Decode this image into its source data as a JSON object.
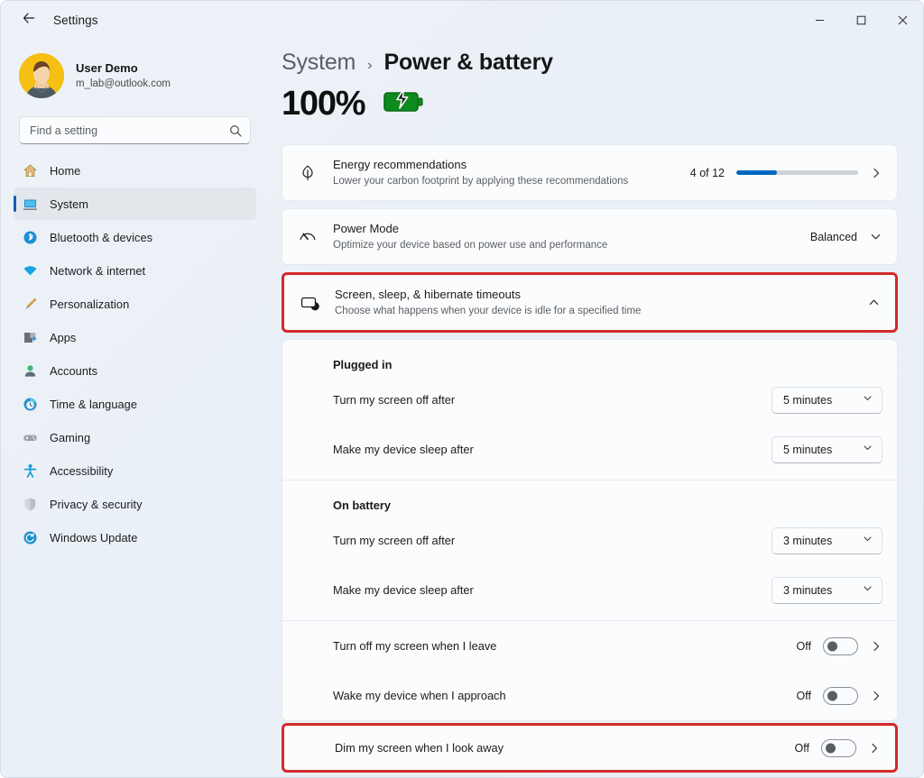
{
  "window": {
    "title": "Settings",
    "back_icon": "back-arrow-icon",
    "minimize": "–",
    "maximize": "▢",
    "close": "✕"
  },
  "sidebar": {
    "account": {
      "name": "User Demo",
      "email": "m_lab@outlook.com",
      "avatar_color": "#f5bf13"
    },
    "search": {
      "placeholder": "Find a setting",
      "value": "",
      "icon": "search-icon"
    },
    "items": [
      {
        "label": "Home",
        "icon": "home-icon",
        "active": false
      },
      {
        "label": "System",
        "icon": "system-icon",
        "active": true
      },
      {
        "label": "Bluetooth & devices",
        "icon": "bluetooth-icon",
        "active": false
      },
      {
        "label": "Network & internet",
        "icon": "wifi-icon",
        "active": false
      },
      {
        "label": "Personalization",
        "icon": "brush-icon",
        "active": false
      },
      {
        "label": "Apps",
        "icon": "apps-icon",
        "active": false
      },
      {
        "label": "Accounts",
        "icon": "account-icon",
        "active": false
      },
      {
        "label": "Time & language",
        "icon": "clock-icon",
        "active": false
      },
      {
        "label": "Gaming",
        "icon": "gamepad-icon",
        "active": false
      },
      {
        "label": "Accessibility",
        "icon": "accessibility-icon",
        "active": false
      },
      {
        "label": "Privacy & security",
        "icon": "shield-icon",
        "active": false
      },
      {
        "label": "Windows Update",
        "icon": "update-icon",
        "active": false
      }
    ]
  },
  "main": {
    "breadcrumb": {
      "parent": "System",
      "separator": "›",
      "current": "Power & battery"
    },
    "battery": {
      "percent": "100%",
      "icon": "battery-charging-icon",
      "icon_color": "#107c10"
    },
    "energy_recommendations": {
      "title": "Energy recommendations",
      "subtitle": "Lower your carbon footprint by applying these recommendations",
      "count_text": "4 of 12",
      "progress_percent": 33,
      "progress_color": "#0067c0",
      "icon": "leaf-icon",
      "chevron": "chevron-right-icon"
    },
    "power_mode": {
      "title": "Power Mode",
      "subtitle": "Optimize your device based on power use and performance",
      "value": "Balanced",
      "icon": "gauge-icon",
      "chevron": "chevron-down-icon"
    },
    "timeouts": {
      "title": "Screen, sleep, & hibernate timeouts",
      "subtitle": "Choose what happens when your device is idle for a specified time",
      "icon": "monitor-sleep-icon",
      "chevron": "chevron-up-icon",
      "highlighted": true,
      "highlight_color": "#d32a2a",
      "groups": [
        {
          "heading": "Plugged in",
          "rows": [
            {
              "label": "Turn my screen off after",
              "value": "5 minutes"
            },
            {
              "label": "Make my device sleep after",
              "value": "5 minutes"
            }
          ]
        },
        {
          "heading": "On battery",
          "rows": [
            {
              "label": "Turn my screen off after",
              "value": "3 minutes"
            },
            {
              "label": "Make my device sleep after",
              "value": "3 minutes"
            }
          ]
        }
      ],
      "toggles": [
        {
          "label": "Turn off my screen when I leave",
          "state": "Off",
          "on": false,
          "highlighted": false
        },
        {
          "label": "Wake my device when I approach",
          "state": "Off",
          "on": false,
          "highlighted": false
        }
      ],
      "highlighted_toggle": {
        "label": "Dim my screen when I look away",
        "state": "Off",
        "on": false,
        "highlighted": true
      }
    }
  }
}
